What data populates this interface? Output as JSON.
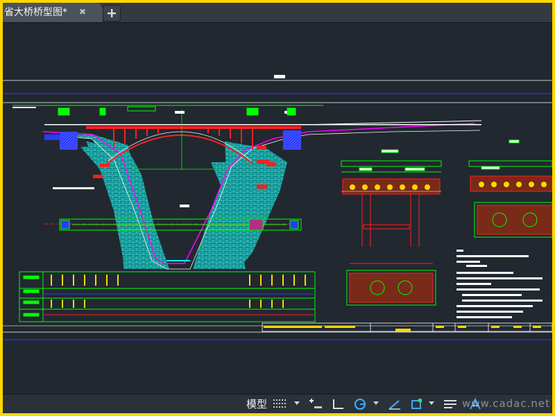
{
  "tab": {
    "title": "省大桥桥型图*",
    "close_icon": "close-icon",
    "new_tab_icon": "plus-icon"
  },
  "statusbar": {
    "model_tab": "模型",
    "watermark": "www.cadac.net",
    "buttons": [
      "grid-icon",
      "snap-mode-icon",
      "ortho-icon",
      "polar-tracking-icon",
      "isodraft-icon",
      "object-snap-icon",
      "lineweight-icon",
      "annotation-scale-icon"
    ]
  },
  "colors": {
    "background": "#212830",
    "frame_border": "#ffd800",
    "cad_green": "#00ff00",
    "cad_red": "#ff2020",
    "cad_cyan": "#00ffff",
    "cad_blue": "#2a3bff",
    "cad_magenta": "#ff00ff",
    "accent_blue": "#3fa9ff"
  }
}
